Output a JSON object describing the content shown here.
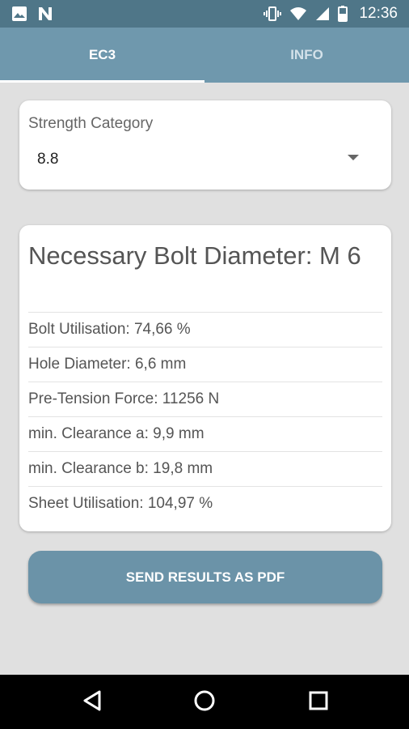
{
  "status_bar": {
    "time": "12:36",
    "left_icons": [
      "image-icon",
      "n-icon"
    ],
    "right_icons": [
      "vibrate-icon",
      "wifi-icon",
      "signal-icon",
      "battery-icon"
    ]
  },
  "tabs": [
    {
      "label": "EC3",
      "active": true
    },
    {
      "label": "INFO",
      "active": false
    }
  ],
  "strength": {
    "label": "Strength Category",
    "value": "8.8"
  },
  "results": {
    "title": "Necessary Bolt Diameter: M 6",
    "rows": [
      "Bolt Utilisation: 74,66 %",
      "Hole Diameter: 6,6 mm",
      "Pre-Tension Force: 11256 N",
      "min. Clearance a: 9,9 mm",
      "min. Clearance b: 19,8 mm",
      "Sheet Utilisation: 104,97 %"
    ]
  },
  "send_button": {
    "label": "SEND RESULTS AS PDF"
  },
  "nav_icons": [
    "back-icon",
    "home-icon",
    "recents-icon"
  ],
  "colors": {
    "status_bar": "#4f7688",
    "tab_bar": "#6f98ad",
    "button": "#6b93a8",
    "background": "#e0e0e0"
  }
}
